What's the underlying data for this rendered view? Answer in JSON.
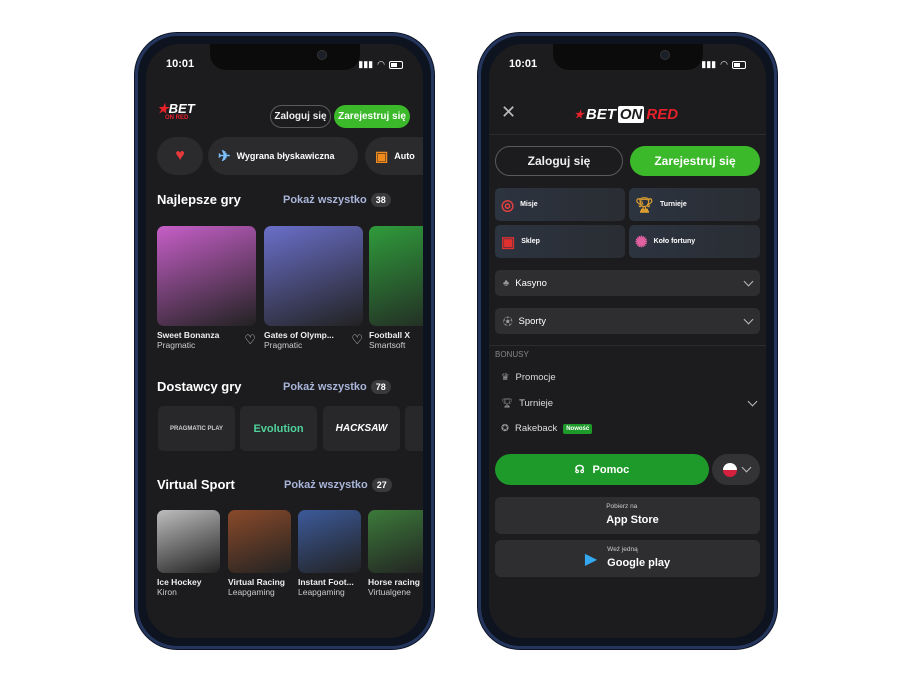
{
  "status": {
    "time": "10:01"
  },
  "phone1": {
    "logo": {
      "line1": "BET",
      "line2": "ON RED"
    },
    "login_label": "Zaloguj się",
    "register_label": "Zarejestruj się",
    "chips": [
      {
        "icon": "heart-icon",
        "label": ""
      },
      {
        "icon": "plane-icon",
        "label": "Wygrana błyskawiczna"
      },
      {
        "icon": "slot-icon",
        "label": "Auto"
      }
    ],
    "top_games": {
      "title": "Najlepsze gry",
      "show_all": "Pokaż wszystko",
      "count": "38",
      "items": [
        {
          "name": "Sweet Bonanza",
          "provider": "Pragmatic",
          "color": "#c65fc8"
        },
        {
          "name": "Gates of Olymp...",
          "provider": "Pragmatic",
          "color": "#6a6fc9"
        },
        {
          "name": "Football X",
          "provider": "Smartsoft",
          "color": "#2f9b3b"
        }
      ]
    },
    "providers": {
      "title": "Dostawcy gry",
      "show_all": "Pokaż wszystko",
      "count": "78",
      "items": [
        {
          "name": "PRAGMATIC PLAY",
          "color": "#ccc"
        },
        {
          "name": "Evolution",
          "color": "#4fd39a"
        },
        {
          "name": "HACKSAW",
          "color": "#eee"
        }
      ]
    },
    "virtual": {
      "title": "Virtual Sport",
      "show_all": "Pokaż wszystko",
      "count": "27",
      "items": [
        {
          "name": "Ice Hockey",
          "provider": "Kiron",
          "color": "#bdbdbd"
        },
        {
          "name": "Virtual Racing",
          "provider": "Leapgaming",
          "color": "#8a4a2a"
        },
        {
          "name": "Instant Foot...",
          "provider": "Leapgaming",
          "color": "#3c5a9a"
        },
        {
          "name": "Horse racing",
          "provider": "Virtualgene",
          "color": "#3c7a3a"
        }
      ]
    }
  },
  "phone2": {
    "logo": {
      "bet": "BET",
      "on": "ON",
      "red": "RED"
    },
    "login_label": "Zaloguj się",
    "register_label": "Zarejestruj się",
    "tiles": [
      {
        "label": "Misje",
        "icon": "target-icon"
      },
      {
        "label": "Turnieje",
        "icon": "trophy-icon"
      },
      {
        "label": "Sklep",
        "icon": "shop-icon"
      },
      {
        "label": "Koło fortuny",
        "icon": "wheel-icon"
      }
    ],
    "sections": [
      {
        "label": "Kasyno",
        "icon": "cherry-icon"
      },
      {
        "label": "Sporty",
        "icon": "ball-icon"
      }
    ],
    "bonus_header": "BONUSY",
    "bonus_items": [
      {
        "label": "Promocje",
        "icon": "crown-icon"
      },
      {
        "label": "Turnieje",
        "icon": "trophy-icon"
      },
      {
        "label": "Rakeback",
        "icon": "medal-icon",
        "badge": "Nowość"
      }
    ],
    "help_label": "Pomoc",
    "app_store": {
      "small": "Pobierz na",
      "big": "App Store"
    },
    "google_play": {
      "small": "Weź jedną",
      "big": "Google play"
    },
    "colors": {
      "green": "#3cb82b",
      "help_green": "#1e9a2a",
      "brand_red": "#e8202a"
    }
  }
}
